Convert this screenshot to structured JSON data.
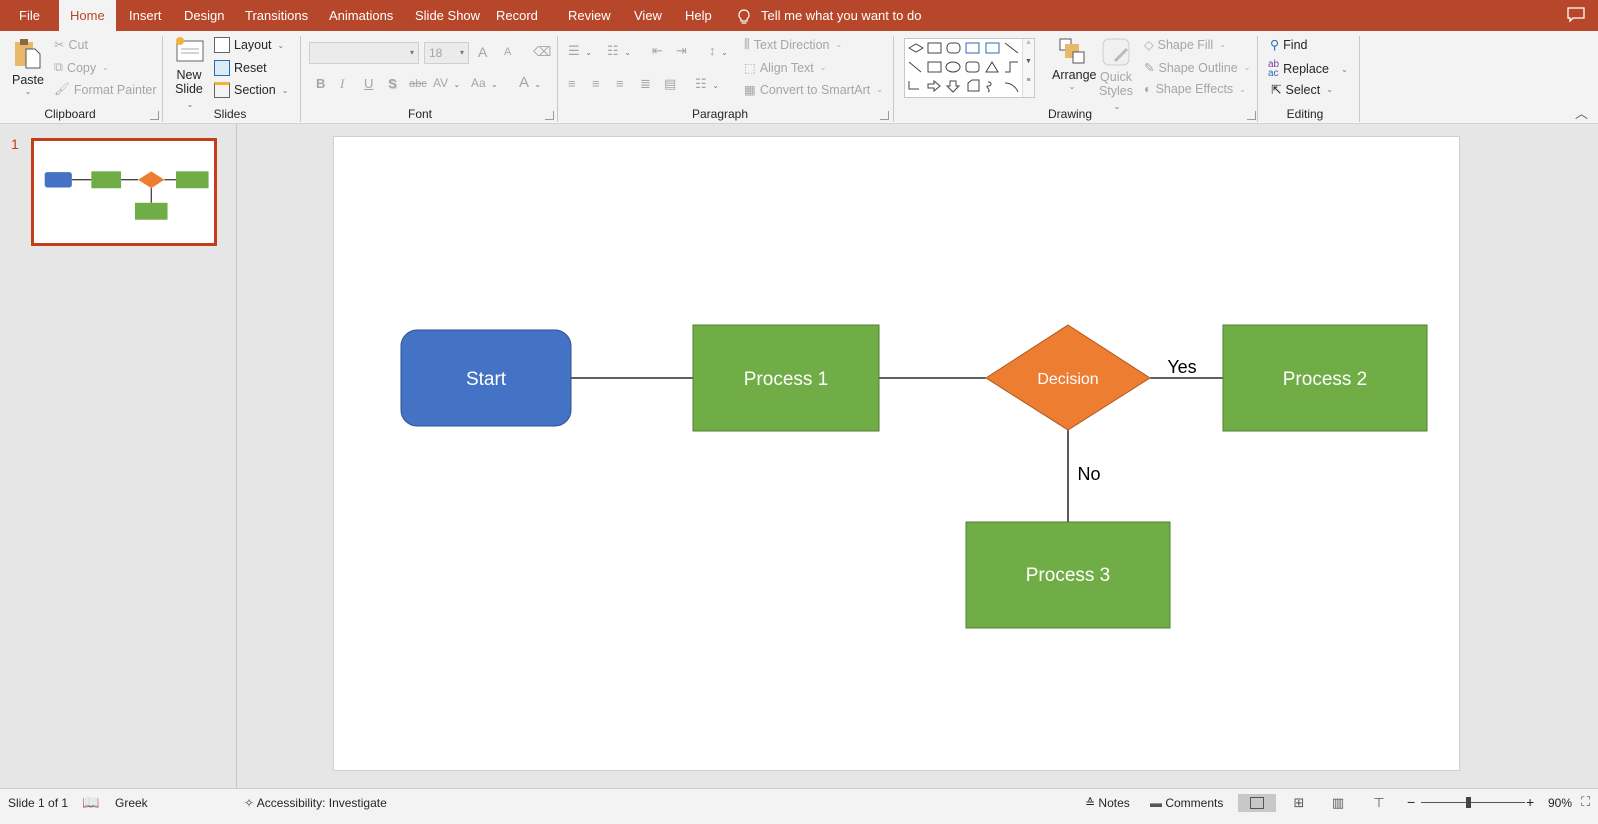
{
  "tabs": [
    {
      "label": "File",
      "active": false
    },
    {
      "label": "Home",
      "active": true
    },
    {
      "label": "Insert",
      "active": false
    },
    {
      "label": "Design",
      "active": false
    },
    {
      "label": "Transitions",
      "active": false
    },
    {
      "label": "Animations",
      "active": false
    },
    {
      "label": "Slide Show",
      "active": false
    },
    {
      "label": "Record",
      "active": false
    },
    {
      "label": "Review",
      "active": false
    },
    {
      "label": "View",
      "active": false
    },
    {
      "label": "Help",
      "active": false
    }
  ],
  "tell_me": {
    "placeholder": "Tell me what you want to do",
    "icon": "lightbulb-icon"
  },
  "ribbon": {
    "clipboard": {
      "label": "Clipboard",
      "paste": "Paste",
      "cut": "Cut",
      "copy": "Copy",
      "format_painter": "Format Painter"
    },
    "slides": {
      "label": "Slides",
      "new_slide_line1": "New",
      "new_slide_line2": "Slide",
      "layout": "Layout",
      "reset": "Reset",
      "section": "Section"
    },
    "font": {
      "label": "Font",
      "font_name": "",
      "font_size": "18",
      "bold": "B",
      "italic": "I",
      "underline": "U",
      "shadow": "S",
      "strikethrough": "abc",
      "spacing": "AV",
      "change_case": "Aa",
      "font_color": "A",
      "grow": "A",
      "shrink": "A"
    },
    "paragraph": {
      "label": "Paragraph",
      "text_direction": "Text Direction",
      "align_text": "Align Text",
      "convert_smartart": "Convert to SmartArt"
    },
    "drawing": {
      "label": "Drawing",
      "arrange": "Arrange",
      "quick_styles_line1": "Quick",
      "quick_styles_line2": "Styles",
      "shape_fill": "Shape Fill",
      "shape_outline": "Shape Outline",
      "shape_effects": "Shape Effects"
    },
    "editing": {
      "label": "Editing",
      "find": "Find",
      "replace": "Replace",
      "select": "Select"
    }
  },
  "thumbnails": [
    {
      "number": "1",
      "selected": true
    }
  ],
  "slide": {
    "shapes": [
      {
        "id": "start",
        "type": "rounded-rect",
        "text": "Start",
        "color": "#4472c4"
      },
      {
        "id": "process1",
        "type": "rect",
        "text": "Process 1",
        "color": "#70ad47"
      },
      {
        "id": "decision",
        "type": "diamond",
        "text": "Decision",
        "color": "#ed7d31"
      },
      {
        "id": "process2",
        "type": "rect",
        "text": "Process 2",
        "color": "#70ad47"
      },
      {
        "id": "process3",
        "type": "rect",
        "text": "Process 3",
        "color": "#70ad47"
      }
    ],
    "connectors": [
      {
        "from": "start",
        "to": "process1",
        "label": ""
      },
      {
        "from": "process1",
        "to": "decision",
        "label": ""
      },
      {
        "from": "decision",
        "to": "process2",
        "label": "Yes"
      },
      {
        "from": "decision",
        "to": "process3",
        "label": "No"
      }
    ]
  },
  "status": {
    "slide_info": "Slide 1 of 1",
    "language": "Greek",
    "accessibility": "Accessibility: Investigate",
    "notes": "Notes",
    "comments": "Comments",
    "zoom_level": "90%",
    "zoom_fraction": 0.45
  },
  "colors": {
    "accent": "#b7472a",
    "thumb_border": "#c43e1c"
  }
}
